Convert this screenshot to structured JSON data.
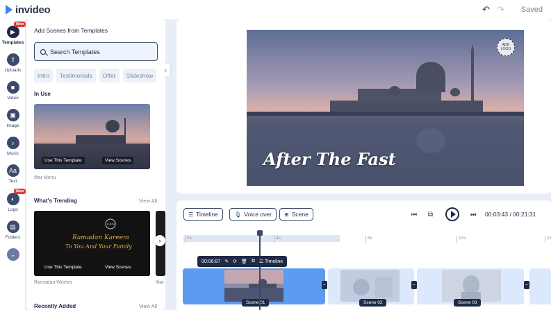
{
  "app": {
    "name": "invideo",
    "status": "Saved"
  },
  "rail": [
    {
      "label": "Templates",
      "icon": "templates-icon",
      "badge": "New"
    },
    {
      "label": "Uploads",
      "icon": "upload-icon"
    },
    {
      "label": "Video",
      "icon": "video-icon"
    },
    {
      "label": "Image",
      "icon": "image-icon"
    },
    {
      "label": "Music",
      "icon": "music-icon"
    },
    {
      "label": "Text",
      "icon": "text-icon",
      "glyph": "Aa"
    },
    {
      "label": "Logo",
      "icon": "logo-icon",
      "badge": "New"
    },
    {
      "label": "Folders",
      "icon": "folder-icon"
    }
  ],
  "panel": {
    "title": "Add Scenes from Templates",
    "search_placeholder": "Search Templates",
    "chips": [
      "Intro",
      "Testimonials",
      "Offer",
      "Slideshow"
    ],
    "in_use_label": "In Use",
    "in_use_card": {
      "caption": "Iftar Menu",
      "use_label": "Use This Template",
      "view_label": "View Scenes"
    },
    "trending_label": "What's Trending",
    "view_all": "View All",
    "trending_card": {
      "caption": "Ramadan Wishes",
      "use_label": "Use This Template",
      "view_label": "View Scenes",
      "logo_text": "LOGO",
      "line1": "Ramadan Kareem",
      "line2": "To You And Your Family"
    },
    "trending_card2_caption": "Iftar",
    "recent_label": "Recently Added"
  },
  "preview": {
    "overlay_text": "After The Fast",
    "logo_placeholder": "ADD LOGO"
  },
  "timeline": {
    "timeline_btn": "Timeline",
    "voiceover_btn": "Voice over",
    "scene_btn": "Scene",
    "current_time": "00:03:43",
    "total_time": "00:21:31",
    "ticks": [
      "0s",
      "4s",
      "8s",
      "12s",
      "16"
    ],
    "clip_duration": "00:06:87",
    "clip_timeline_label": "Timeline",
    "scenes": [
      "Scene 01",
      "Scene 02",
      "Scene 03"
    ]
  },
  "colors": {
    "accent": "#3b82f6",
    "active_clip": "#5b9bf0",
    "dark": "#1f2a44"
  }
}
